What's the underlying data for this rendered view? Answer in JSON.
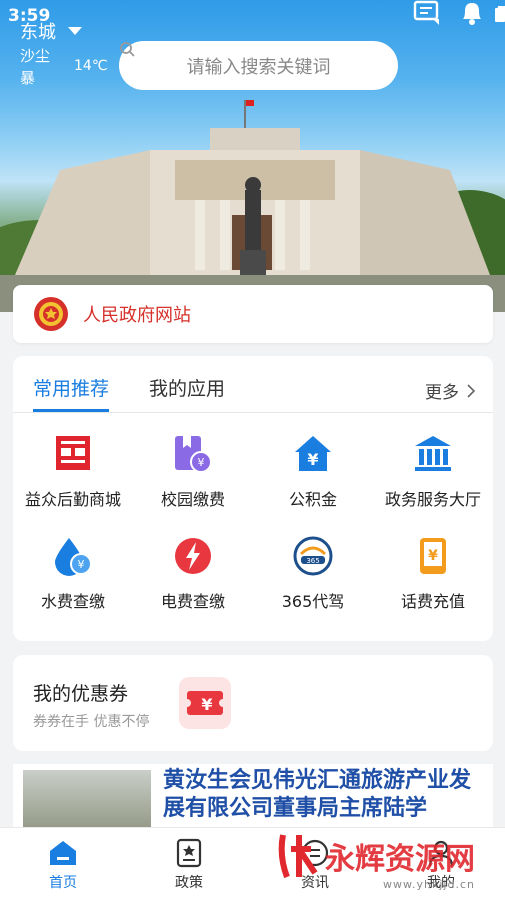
{
  "status": {
    "time": "3:59"
  },
  "header": {
    "city": "东城",
    "weather": "沙尘暴",
    "temperature": "14℃",
    "search_placeholder": "请输入搜索关键词"
  },
  "banner": {
    "text": "人民政府网站"
  },
  "apps": {
    "tabs": [
      {
        "label": "常用推荐",
        "active": true
      },
      {
        "label": "我的应用",
        "active": false
      }
    ],
    "more_label": "更多",
    "items": [
      {
        "label": "益众后勤商城",
        "icon": "mall-icon"
      },
      {
        "label": "校园缴费",
        "icon": "campus-payment-icon"
      },
      {
        "label": "公积金",
        "icon": "housing-fund-icon"
      },
      {
        "label": "政务服务大厅",
        "icon": "government-hall-icon"
      },
      {
        "label": "水费查缴",
        "icon": "water-fee-icon"
      },
      {
        "label": "电费查缴",
        "icon": "electric-fee-icon"
      },
      {
        "label": "365代驾",
        "icon": "designated-driver-icon"
      },
      {
        "label": "话费充值",
        "icon": "phone-recharge-icon"
      }
    ]
  },
  "coupon": {
    "title": "我的优惠券",
    "subtitle": "券券在手 优惠不停"
  },
  "news": {
    "title": "黄汝生会见伟光汇通旅游产业发展有限公司董事局主席陆学"
  },
  "bottom_nav": [
    {
      "label": "首页",
      "active": true
    },
    {
      "label": "政策",
      "active": false
    },
    {
      "label": "资讯",
      "active": false
    },
    {
      "label": "我的",
      "active": false
    }
  ],
  "watermark": {
    "text": "永辉资源网",
    "url": "www.yhkjjd.cn"
  },
  "colors": {
    "accent": "#1a7ee0",
    "banner_text": "#d6302a",
    "news_title": "#1f4fa6"
  }
}
